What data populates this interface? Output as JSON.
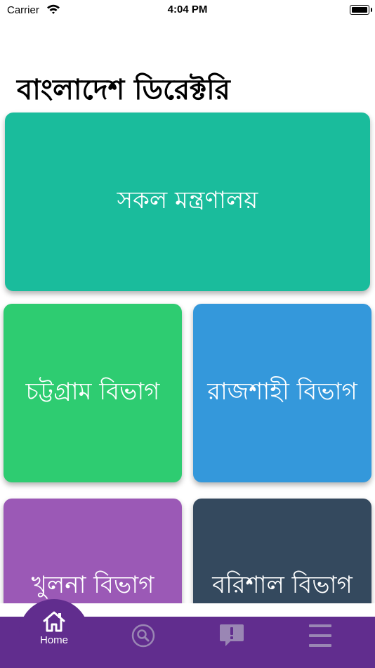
{
  "status_bar": {
    "carrier": "Carrier",
    "time": "4:04 PM"
  },
  "page": {
    "title": "বাংলাদেশ ডিরেক্টরি"
  },
  "cards": [
    {
      "label": "সকল মন্ত্রণালয়",
      "color": "#1ABC9C"
    },
    {
      "label": "চট্টগ্রাম বিভাগ",
      "color": "#2ECC71"
    },
    {
      "label": "রাজশাহী বিভাগ",
      "color": "#3498DB"
    },
    {
      "label": "খুলনা বিভাগ",
      "color": "#9B59B6"
    },
    {
      "label": "বরিশাল বিভাগ",
      "color": "#34495E"
    }
  ],
  "tab_bar": {
    "color": "#612D8E",
    "items": [
      {
        "label": "Home",
        "icon": "home-icon",
        "active": true
      },
      {
        "icon": "search-icon"
      },
      {
        "icon": "feedback-icon"
      },
      {
        "icon": "menu-icon"
      }
    ]
  }
}
